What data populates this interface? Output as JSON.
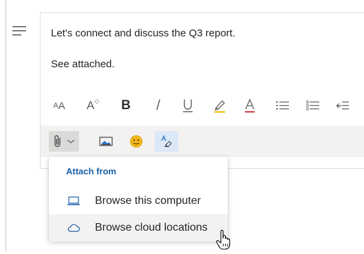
{
  "message": {
    "line1": "Let's connect and discuss the Q3 report.",
    "line2": "See attached."
  },
  "toolbar": {
    "font_size_glyph": "AA",
    "grow_font_glyph": "A",
    "bold_glyph": "B",
    "italic_glyph": "/",
    "underline_glyph": "U",
    "font_color_glyph": "A",
    "highlight_color": "#f0c11b",
    "font_color_accent": "#c2292e"
  },
  "attach_menu": {
    "header": "Attach from",
    "items": [
      {
        "label": "Browse this computer",
        "icon": "laptop-icon"
      },
      {
        "label": "Browse cloud locations",
        "icon": "cloud-icon"
      }
    ],
    "hovered_index": 1
  },
  "colors": {
    "accent": "#1b5fa8",
    "emoji": "#f2b71a",
    "toolbar_bg": "#f3f2f1",
    "hover_bg": "#f3f2f1"
  }
}
